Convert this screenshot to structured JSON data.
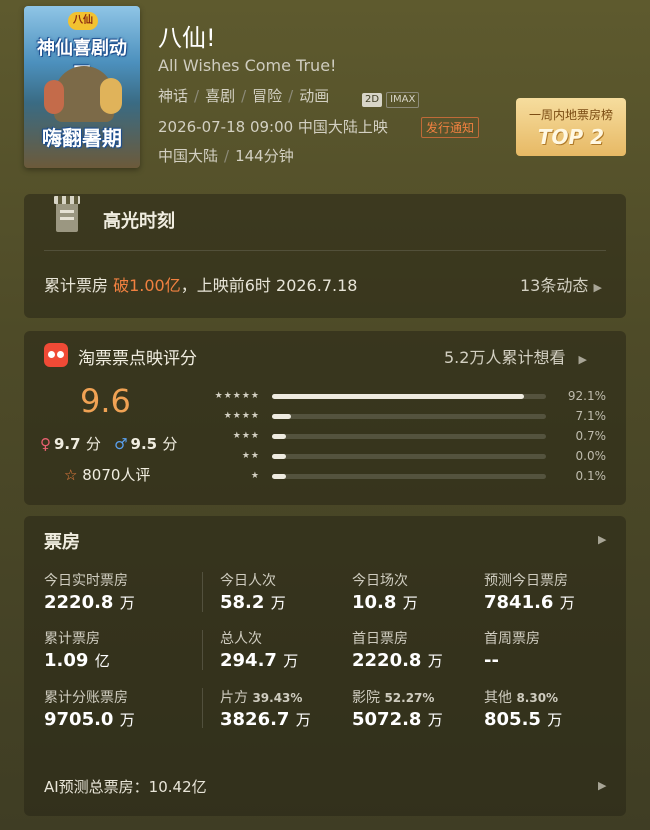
{
  "header": {
    "poster_top_text": "神仙喜剧动画",
    "poster_bottom_text": "嗨翻暑期",
    "poster_badge_text": "八仙",
    "title": "八仙!",
    "subtitle": "All Wishes Come True!",
    "genres": [
      "神话",
      "喜剧",
      "冒险",
      "动画"
    ],
    "format_2d": "2D",
    "format_imax": "IMAX",
    "release": "2026-07-18 09:00 中国大陆上映",
    "notice": "发行通知",
    "region": "中国大陆",
    "duration": "144分钟"
  },
  "rank_badge": {
    "label": "一周内地票房榜",
    "rank": "TOP 2"
  },
  "highlight": {
    "title": "高光时刻",
    "text_prefix": "累计票房",
    "text_highlight": "破1.00亿",
    "text_suffix": "，上映前6时 2026.7.18",
    "more": "13条动态"
  },
  "rating": {
    "source": "淘票票点映评分",
    "want_to_watch": "5.2万人累计想看",
    "score": "9.6",
    "female_score": "9.7",
    "male_score": "9.5",
    "score_unit": "分",
    "rated_count": "8070人评",
    "distribution": [
      {
        "stars": "★★★★★",
        "value": 92.1,
        "label": "92.1%"
      },
      {
        "stars": "★★★★",
        "value": 7.1,
        "label": "7.1%"
      },
      {
        "stars": "★★★",
        "value": 0.7,
        "label": "0.7%"
      },
      {
        "stars": "★★",
        "value": 0.0,
        "label": "0.0%"
      },
      {
        "stars": "★",
        "value": 0.1,
        "label": "0.1%"
      }
    ]
  },
  "box_office": {
    "title": "票房",
    "rows": [
      [
        {
          "label": "今日实时票房",
          "value": "2220.8",
          "unit": "万"
        },
        {
          "label": "今日人次",
          "value": "58.2",
          "unit": "万"
        },
        {
          "label": "今日场次",
          "value": "10.8",
          "unit": "万"
        },
        {
          "label": "预测今日票房",
          "value": "7841.6",
          "unit": "万"
        }
      ],
      [
        {
          "label": "累计票房",
          "value": "1.09",
          "unit": "亿"
        },
        {
          "label": "总人次",
          "value": "294.7",
          "unit": "万"
        },
        {
          "label": "首日票房",
          "value": "2220.8",
          "unit": "万"
        },
        {
          "label": "首周票房",
          "value": "--",
          "unit": ""
        }
      ],
      [
        {
          "label": "累计分账票房",
          "value": "9705.0",
          "unit": "万",
          "share": ""
        },
        {
          "label": "片方",
          "value": "3826.7",
          "unit": "万",
          "share": "39.43%"
        },
        {
          "label": "影院",
          "value": "5072.8",
          "unit": "万",
          "share": "52.27%"
        },
        {
          "label": "其他",
          "value": "805.5",
          "unit": "万",
          "share": "8.30%"
        }
      ]
    ],
    "ai_forecast": "AI预测总票房：10.42亿"
  },
  "colors": {
    "accent_orange": "#f08040",
    "score_orange": "#f0a254",
    "taopiaopiao_red": "#f04a36",
    "female": "#e86070",
    "male": "#5aa0ee"
  }
}
